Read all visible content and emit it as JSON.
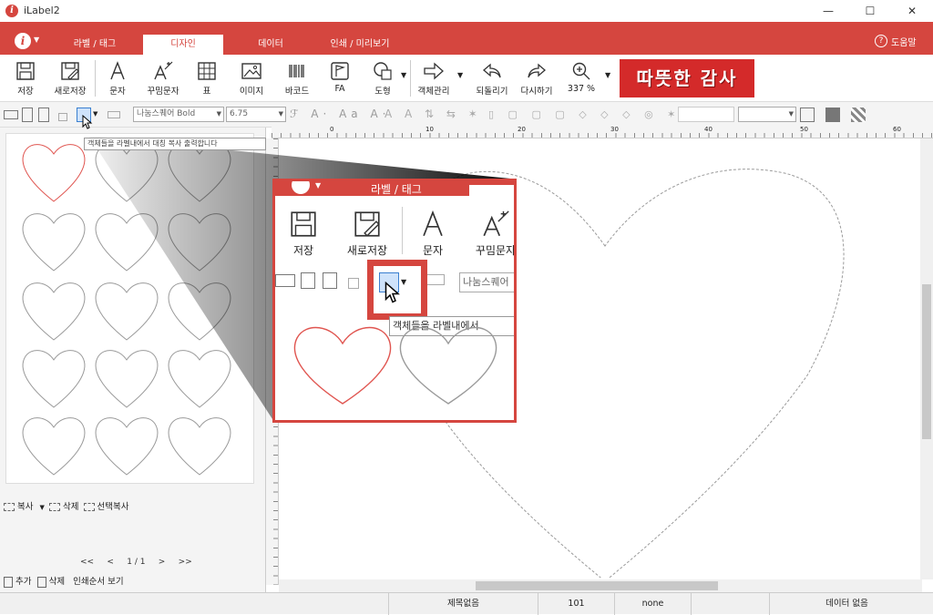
{
  "app": {
    "title": "iLabel2",
    "logo_letter": "i"
  },
  "window": {
    "minimize": "—",
    "maximize": "☐",
    "close": "✕"
  },
  "tabs": [
    {
      "label": "라벨 / 태그"
    },
    {
      "label": "디자인",
      "active": true
    },
    {
      "label": "데이터"
    },
    {
      "label": "인쇄 / 미리보기"
    }
  ],
  "help": {
    "label": "도움말",
    "icon_glyph": "?"
  },
  "toolbar": {
    "save": "저장",
    "save_as": "새로저장",
    "text": "문자",
    "deco_text": "꾸밈문자",
    "table": "표",
    "image": "이미지",
    "barcode": "바코드",
    "fa": "FA",
    "shape": "도형",
    "object_manage": "객체관리",
    "undo": "되돌리기",
    "redo": "다시하기",
    "zoom": "337 %"
  },
  "banner": {
    "text": "따뜻한 감사"
  },
  "format_bar": {
    "font": "나눔스퀘어 Bold",
    "size": "6.75"
  },
  "tooltip": {
    "text": "객체들을 라벨내에서 대칭 복사 출력합니다"
  },
  "zoom_callout": {
    "tab": "라벨 / 태그",
    "save": "저장",
    "save_as": "새로저장",
    "text": "문자",
    "deco_text": "꾸밈문자",
    "font": "나눔스퀘어",
    "tooltip": "객체들을 라벨내에서"
  },
  "left_panel": {
    "copy": "복사",
    "delete": "삭제",
    "select_copy": "선택복사",
    "pager": {
      "first": "<<",
      "prev": "<",
      "page": "1 / 1",
      "next": ">",
      "last": ">>"
    },
    "add": "추가",
    "remove": "삭제",
    "print_order": "인쇄순서 보기"
  },
  "ruler": {
    "ticks": [
      "0",
      "10",
      "20",
      "30",
      "40",
      "50",
      "60"
    ]
  },
  "status": {
    "title": "제목없음",
    "count": "101",
    "mode": "none",
    "data": "데이터 없음"
  },
  "colors": {
    "accent": "#d5463f",
    "banner": "#d42a2a",
    "heart_selected": "#e05550",
    "heart": "#9a9a9a"
  },
  "icons": {
    "save": "save-icon",
    "save_as": "save-as-icon",
    "text": "text-icon",
    "deco": "magic-text-icon",
    "table": "table-icon",
    "image": "image-icon",
    "barcode": "barcode-icon",
    "fa": "flag-icon",
    "shape": "shape-icon",
    "object": "arrow-right-icon",
    "undo": "undo-icon",
    "redo": "redo-icon",
    "zoom": "magnifier-icon"
  }
}
